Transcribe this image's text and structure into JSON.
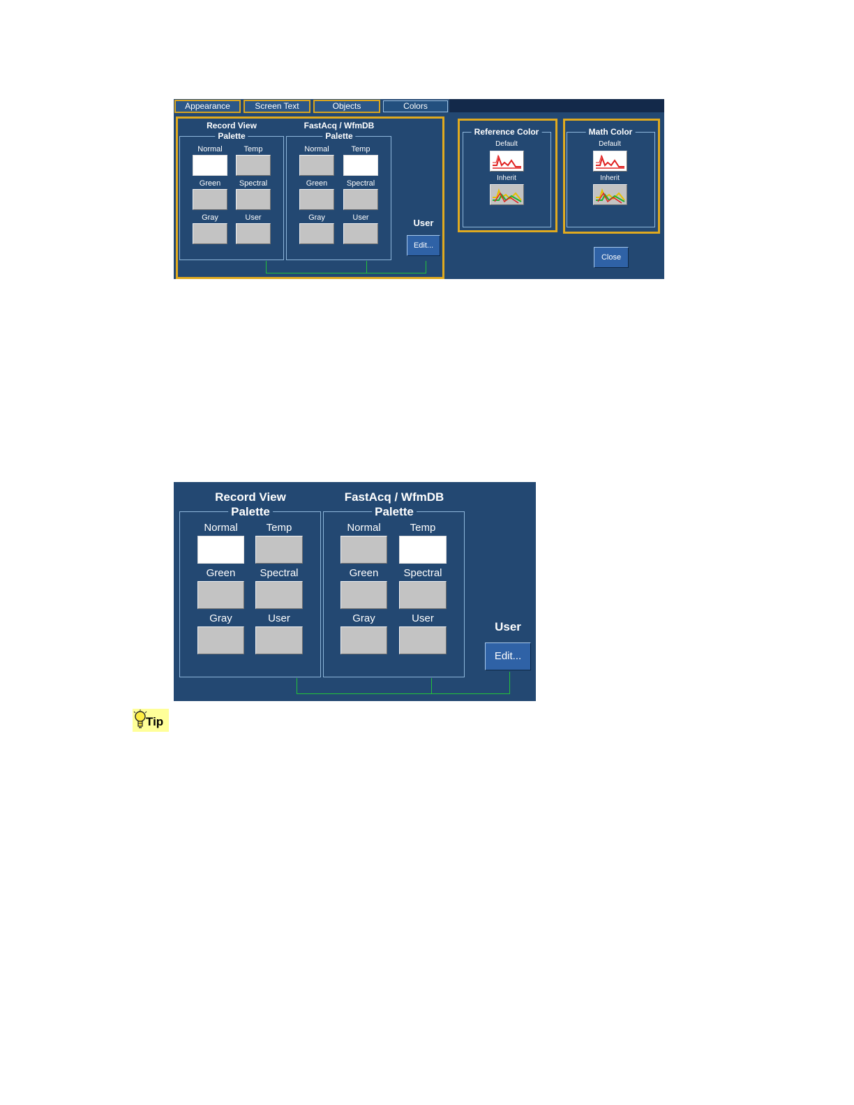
{
  "top_dialog": {
    "tabs": [
      {
        "label": "Appearance",
        "active": false
      },
      {
        "label": "Screen Text",
        "active": false
      },
      {
        "label": "Objects",
        "active": false
      },
      {
        "label": "Colors",
        "active": true
      }
    ],
    "record_view": {
      "title_line1": "Record View",
      "title_line2": "Palette"
    },
    "fastacq": {
      "title_line1": "FastAcq / WfmDB",
      "title_line2": "Palette"
    },
    "palette_options": [
      "Normal",
      "Temp",
      "Green",
      "Spectral",
      "Gray",
      "User"
    ],
    "record_view_selected": "Normal",
    "fastacq_selected": "Temp",
    "user_label": "User",
    "edit_label": "Edit...",
    "reference_color": {
      "title": "Reference Color",
      "default_label": "Default",
      "inherit_label": "Inherit"
    },
    "math_color": {
      "title": "Math Color",
      "default_label": "Default",
      "inherit_label": "Inherit"
    },
    "close_label": "Close"
  },
  "zoom_panel": {
    "record_view": {
      "title_line1": "Record View",
      "title_line2": "Palette"
    },
    "fastacq": {
      "title_line1": "FastAcq / WfmDB",
      "title_line2": "Palette"
    },
    "palette_options": [
      "Normal",
      "Temp",
      "Green",
      "Spectral",
      "Gray",
      "User"
    ],
    "user_label": "User",
    "edit_label": "Edit..."
  },
  "tip": {
    "label": "Tip"
  },
  "colors": {
    "panel_bg": "#234872",
    "highlight_border": "#e0aa1f",
    "connector_line": "#23c43a",
    "swatch_gray": "#c3c3c3",
    "tip_bg": "#ffff99"
  }
}
